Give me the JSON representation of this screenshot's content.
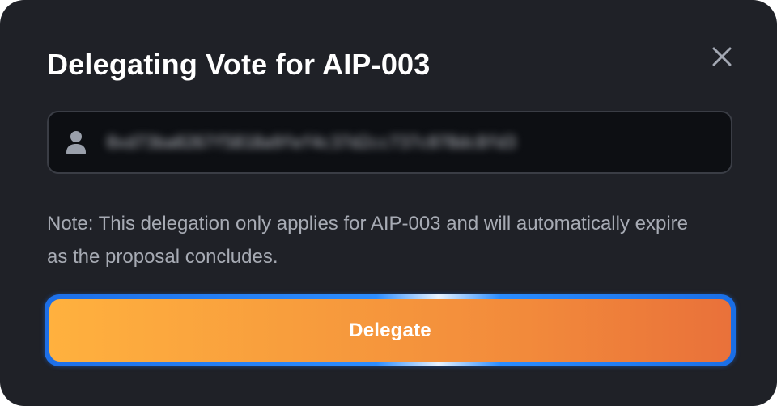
{
  "dialog": {
    "title": "Delegating Vote for AIP-003",
    "close_icon": "close-icon",
    "address_field": {
      "icon": "user-icon",
      "value": "0xd73ba0267f5818a9fef4c37d2cc737c078dc8fd3"
    },
    "note": "Note: This delegation only applies for AIP-003 and will automatically expire as the proposal concludes.",
    "delegate_button": {
      "label": "Delegate"
    }
  },
  "colors": {
    "background": "#1f2127",
    "field_background": "#0d0f13",
    "note_text": "#a7abb4",
    "button_gradient_start": "#ffb13e",
    "button_gradient_end": "#e9713a",
    "button_border": "#2d8dff"
  }
}
